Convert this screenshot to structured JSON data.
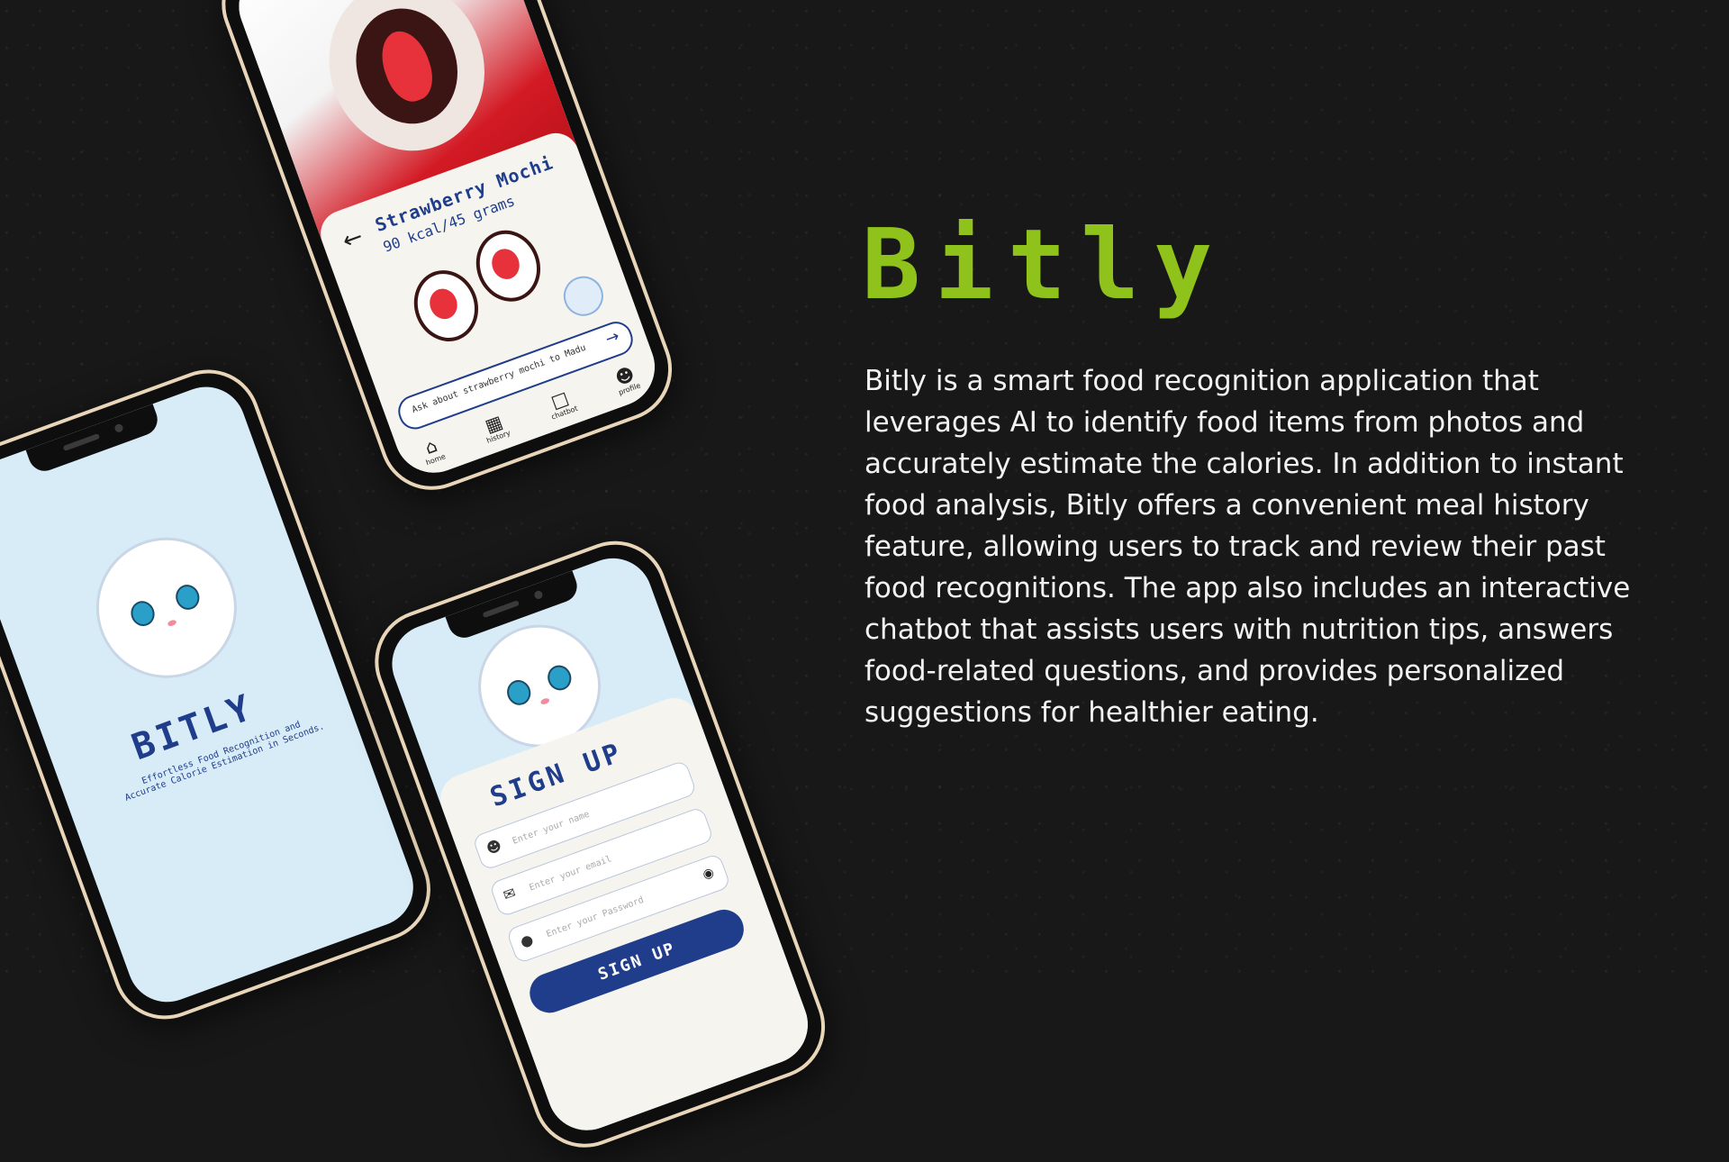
{
  "colors": {
    "accent": "#8fc21a",
    "app_blue": "#1f3d8a",
    "background": "#181818",
    "phone_frame": "#e9d6b8",
    "app_bg": "#d8ecf8"
  },
  "slide": {
    "title": "Bitly",
    "description": "Bitly is a smart food recognition application that leverages AI to identify food items from photos and accurately estimate the calories. In addition to instant food analysis, Bitly offers a convenient meal history feature, allowing users to track and review their past food recognitions. The app also includes an interactive chatbot that assists users with nutrition tips, answers food-related questions, and provides personalized suggestions for healthier eating."
  },
  "detail_screen": {
    "back_icon": "arrow-left-icon",
    "food_name": "Strawberry Mochi",
    "food_calories": "90 kcal/45 grams",
    "ask_placeholder": "Ask about strawberry mochi to Madu",
    "send_icon": "arrow-right-icon",
    "nav": [
      {
        "label": "home",
        "icon": "home-icon"
      },
      {
        "label": "history",
        "icon": "calendar-icon"
      },
      {
        "label": "chatbot",
        "icon": "chat-icon"
      },
      {
        "label": "profile",
        "icon": "user-icon"
      }
    ]
  },
  "splash_screen": {
    "app_name": "BITLY",
    "tagline": "Effortless Food Recognition and Accurate Calorie Estimation in Seconds."
  },
  "signup_screen": {
    "title": "SIGN UP",
    "fields": [
      {
        "placeholder": "Enter your name",
        "icon": "user-icon"
      },
      {
        "placeholder": "Enter your email",
        "icon": "mail-icon"
      },
      {
        "placeholder": "Enter your Password",
        "icon": "lock-icon"
      }
    ],
    "eye_icon": "eye-off-icon",
    "button_label": "SIGN UP"
  }
}
